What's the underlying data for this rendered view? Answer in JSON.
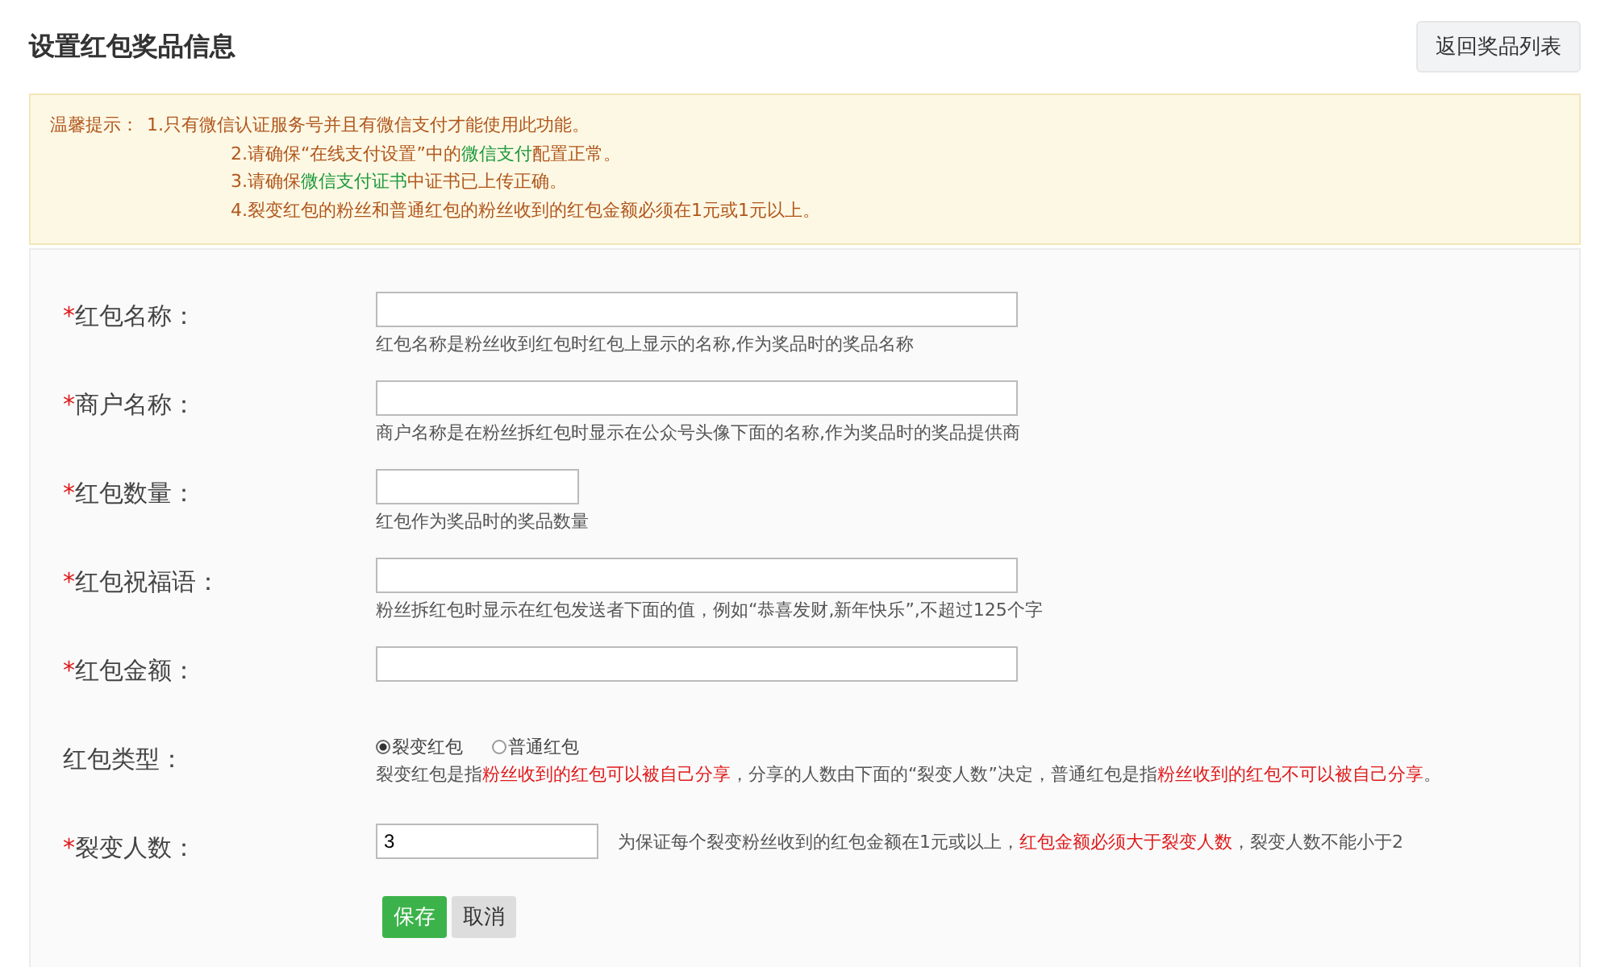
{
  "header": {
    "title": "设置红包奖品信息",
    "back_button": "返回奖品列表"
  },
  "notice": {
    "prefix": "温馨提示：",
    "lines": [
      [
        {
          "kind": "normal",
          "text": "1.只有微信认证服务号并且有微信支付才能使用此功能。"
        }
      ],
      [
        {
          "kind": "normal",
          "text": "2.请确保“在线支付设置”中的"
        },
        {
          "kind": "green",
          "text": "微信支付"
        },
        {
          "kind": "normal",
          "text": "配置正常。"
        }
      ],
      [
        {
          "kind": "normal",
          "text": "3.请确保"
        },
        {
          "kind": "green",
          "text": "微信支付证书"
        },
        {
          "kind": "normal",
          "text": "中证书已上传正确。"
        }
      ],
      [
        {
          "kind": "normal",
          "text": "4.裂变红包的粉丝和普通红包的粉丝收到的红包金额必须在1元或1元以上。"
        }
      ]
    ]
  },
  "fields": [
    {
      "kind": "text",
      "mark": "*",
      "label": "红包名称：",
      "hint": "红包名称是粉丝收到红包时红包上显示的名称,作为奖品时的奖品名称"
    },
    {
      "kind": "text",
      "mark": "*",
      "label": "商户名称：",
      "hint": "商户名称是在粉丝拆红包时显示在公众号头像下面的名称,作为奖品时的奖品提供商"
    },
    {
      "kind": "short_text",
      "mark": "*",
      "label": "红包数量：",
      "hint": "红包作为奖品时的奖品数量"
    },
    {
      "kind": "text",
      "mark": "*",
      "label": "红包祝福语：",
      "hint": "粉丝拆红包时显示在红包发送者下面的值，例如“恭喜发财,新年快乐”,不超过125个字"
    },
    {
      "kind": "text",
      "mark": "*",
      "label": "红包金额："
    },
    {
      "kind": "radio",
      "label": "红包类型：",
      "options": [
        {
          "label": "裂变红包",
          "selected": true
        },
        {
          "label": "普通红包",
          "selected": false
        }
      ],
      "note": [
        {
          "kind": "normal",
          "text": "裂变红包是指"
        },
        {
          "kind": "red",
          "text": "粉丝收到的红包可以被自己分享"
        },
        {
          "kind": "normal",
          "text": "，分享的人数由下面的“裂变人数”决定，普通红包是指"
        },
        {
          "kind": "red",
          "text": "粉丝收到的红包不可以被自己分享"
        },
        {
          "kind": "normal",
          "text": "。"
        }
      ]
    },
    {
      "kind": "inline",
      "mark": "*",
      "label": "裂变人数：",
      "value": "3",
      "note": [
        {
          "kind": "normal",
          "text": "为保证每个裂变粉丝收到的红包金额在1元或以上，"
        },
        {
          "kind": "red",
          "text": "红包金额必须大于裂变人数"
        },
        {
          "kind": "normal",
          "text": "，裂变人数不能小于2"
        }
      ]
    }
  ],
  "buttons": {
    "save": "保存",
    "cancel": "取消"
  }
}
